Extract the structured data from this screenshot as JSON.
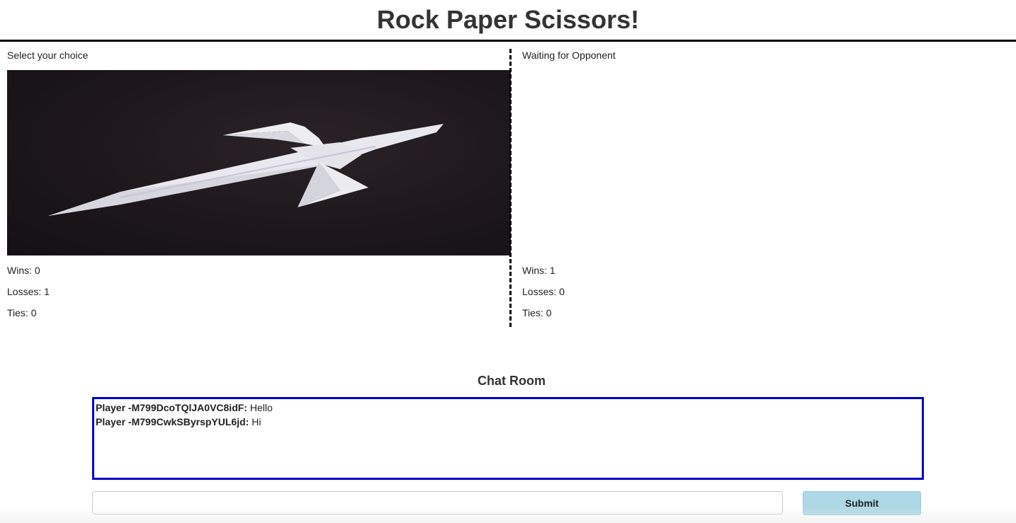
{
  "header": {
    "title": "Rock Paper Scissors!"
  },
  "player": {
    "status": "Select your choice",
    "choice_image": "origami-paper-sword",
    "wins": "Wins: 0",
    "losses": "Losses: 1",
    "ties": "Ties: 0"
  },
  "opponent": {
    "status": "Waiting for Opponent",
    "wins": "Wins: 1",
    "losses": "Losses: 0",
    "ties": "Ties: 0"
  },
  "chat": {
    "title": "Chat Room",
    "messages": [
      {
        "author": "Player -M799DcoTQlJA0VC8idF:",
        "text": " Hello"
      },
      {
        "author": "Player -M799CwkSByrspYUL6jd:",
        "text": " Hi"
      }
    ],
    "input_value": "",
    "submit_label": "Submit"
  },
  "colors": {
    "chat_border": "#0000cd",
    "submit_bg": "#add8e6",
    "image_bg": "#1d171b"
  }
}
